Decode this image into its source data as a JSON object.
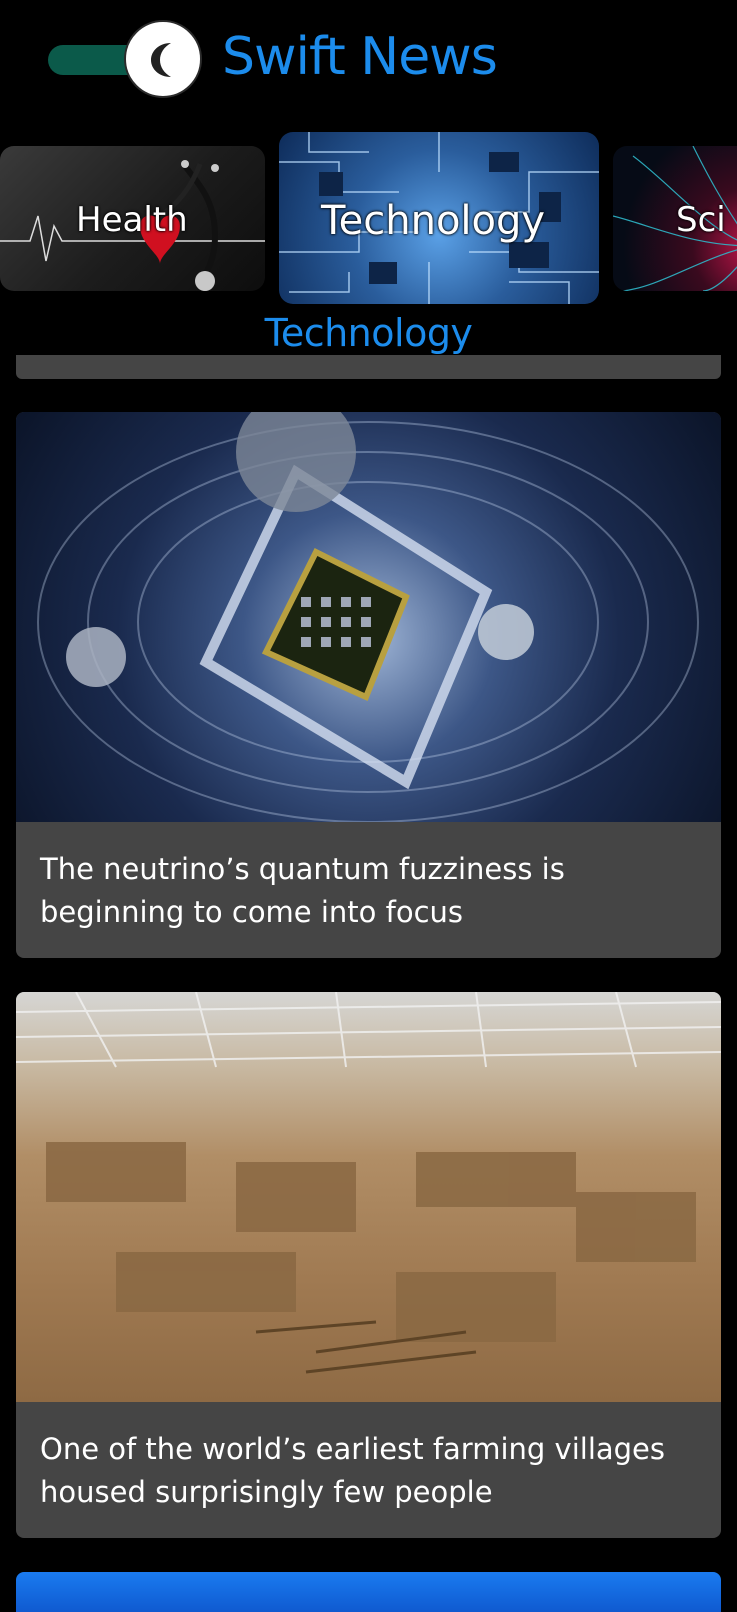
{
  "header": {
    "app_title": "Swift News",
    "theme_toggle": {
      "icon": "moon-icon",
      "state": "dark",
      "track_color": "#0b5a4a"
    },
    "title_color": "#1c8cec"
  },
  "categories": {
    "items": [
      {
        "label": "Health",
        "icon": "stethoscope-heart-image"
      },
      {
        "label": "Technology",
        "icon": "circuit-board-image",
        "selected": true
      },
      {
        "label": "Sci",
        "icon": "neuron-image"
      }
    ]
  },
  "section": {
    "title": "Technology"
  },
  "feed": {
    "articles": [
      {
        "title": "The neutrino’s quantum fuzziness is beginning to come into focus",
        "image": "quantum-chip-image"
      },
      {
        "title": "One of the world’s earliest farming villages housed surprisingly few people",
        "image": "excavation-site-image"
      }
    ]
  },
  "colors": {
    "accent": "#1c8cec",
    "card": "#454545",
    "background": "#000000"
  }
}
